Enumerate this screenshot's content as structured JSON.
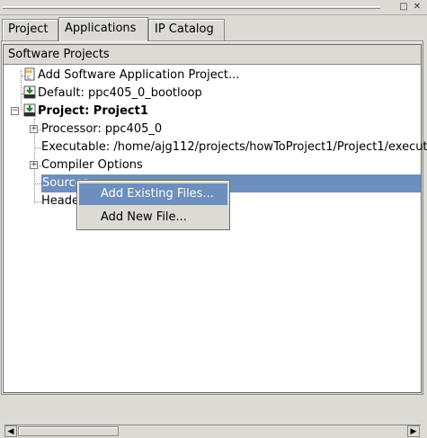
{
  "window": {
    "minimize_glyph": "□",
    "close_glyph": "✕"
  },
  "tabs": [
    {
      "label": "Project"
    },
    {
      "label": "Applications"
    },
    {
      "label": "IP Catalog"
    }
  ],
  "active_tab_index": 1,
  "section_header": "Software Projects",
  "tree": {
    "add_project": "Add Software Application Project...",
    "default_project": "Default: ppc405_0_bootloop",
    "project_name": "Project: Project1",
    "processor": "Processor: ppc405_0",
    "executable": "Executable: /home/ajg112/projects/howToProject1/Project1/execut",
    "compiler_options": "Compiler Options",
    "sources": "Sources",
    "headers": "Headers"
  },
  "context_menu": {
    "items": [
      {
        "label": "Add Existing Files..."
      },
      {
        "label": "Add New File..."
      }
    ],
    "highlighted_index": 0
  },
  "scrollbar": {
    "left_arrow": "◀",
    "right_arrow": "▶"
  },
  "colors": {
    "selection": "#6d8fbd",
    "panel_bg": "#dcdad5",
    "tree_bg": "#ffffff"
  }
}
